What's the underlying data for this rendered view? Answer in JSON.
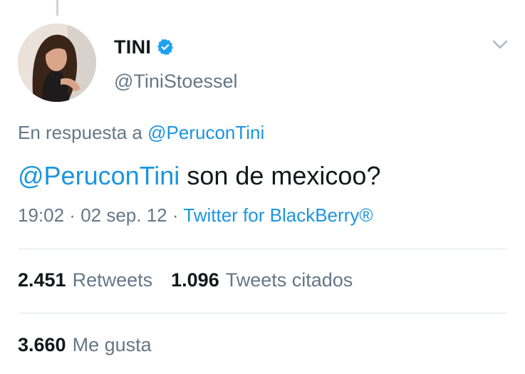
{
  "user": {
    "display_name": "TINI",
    "handle": "@TiniStoessel",
    "verified": true
  },
  "reply": {
    "prefix": "En respuesta a",
    "mention": "@PeruconTini"
  },
  "tweet": {
    "mention": "@PeruconTini",
    "text": " son de mexicoo?"
  },
  "meta": {
    "time": "19:02",
    "separator1": " · ",
    "date": "02 sep. 12",
    "separator2": " · ",
    "source": "Twitter for BlackBerry®"
  },
  "stats": {
    "retweets_count": "2.451",
    "retweets_label": "Retweets",
    "quotes_count": "1.096",
    "quotes_label": "Tweets citados",
    "likes_count": "3.660",
    "likes_label": "Me gusta"
  },
  "colors": {
    "accent": "#1b95e0",
    "secondary_text": "#657786",
    "primary_text": "#14171a",
    "verified_badge": "#1da1f2"
  },
  "icons": {
    "verified": "verified-badge-icon",
    "menu": "chevron-down-icon"
  }
}
